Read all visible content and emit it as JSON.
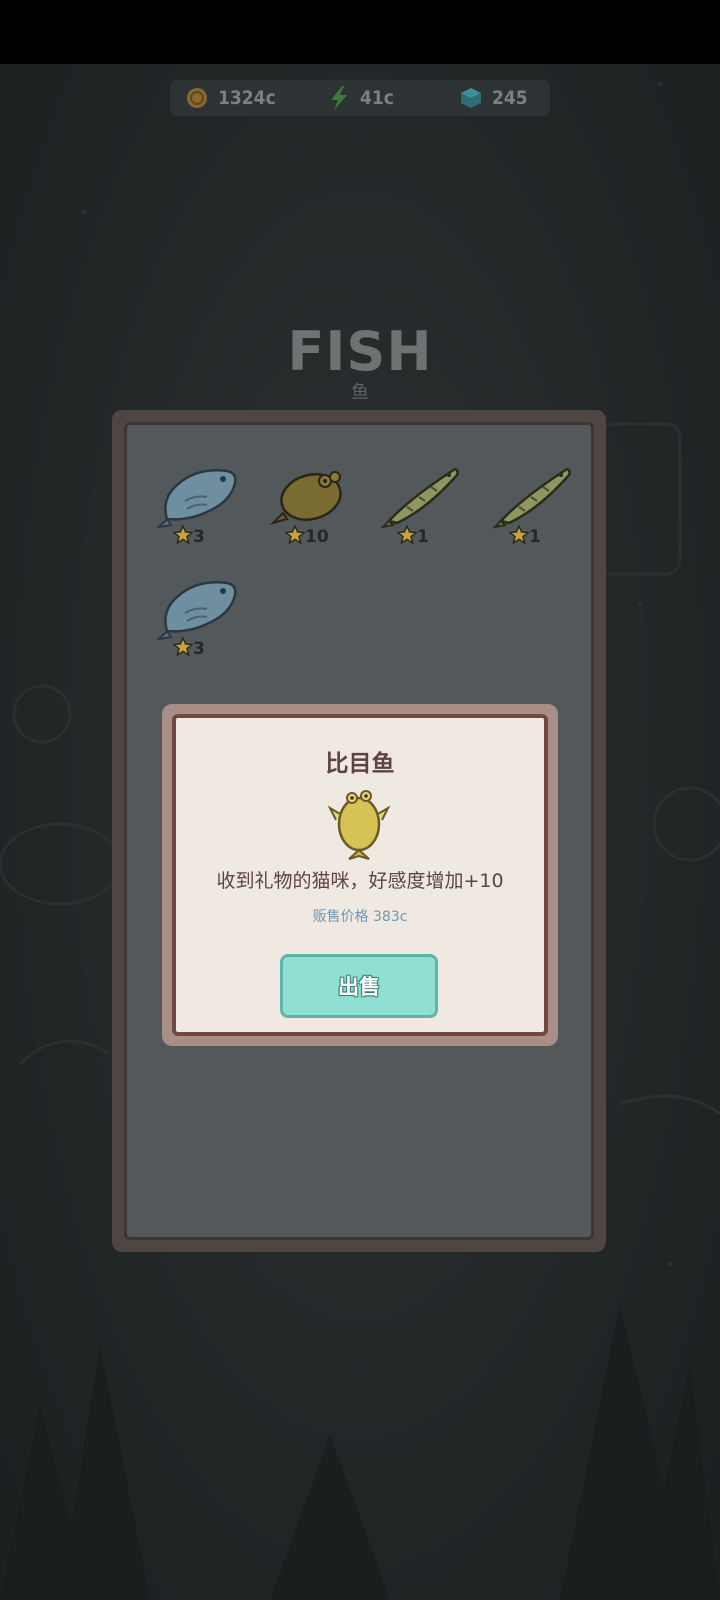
{
  "currency": {
    "coins": {
      "icon": "coin-icon",
      "value": "1324c"
    },
    "energy": {
      "icon": "lightning-icon",
      "value": "41c"
    },
    "gems": {
      "icon": "gem-icon",
      "value": "245"
    }
  },
  "page": {
    "title": "FISH",
    "subtitle": "鱼"
  },
  "inventory": [
    {
      "fish": "blue-fish-icon",
      "count": "3"
    },
    {
      "fish": "flounder-icon",
      "count": "10"
    },
    {
      "fish": "pike-icon",
      "count": "1"
    },
    {
      "fish": "pike-icon",
      "count": "1"
    },
    {
      "fish": "blue-fish-icon",
      "count": "3"
    }
  ],
  "popup": {
    "title": "比目鱼",
    "icon": "flounder-icon",
    "description": "收到礼物的猫咪，好感度增加+10",
    "price": "贩售价格 383c",
    "sell_label": "出售"
  },
  "colors": {
    "board": "#53595b",
    "popup_bg": "#efe9e1",
    "sell_button": "#8fe0d2",
    "price_text": "#6f97b8"
  }
}
